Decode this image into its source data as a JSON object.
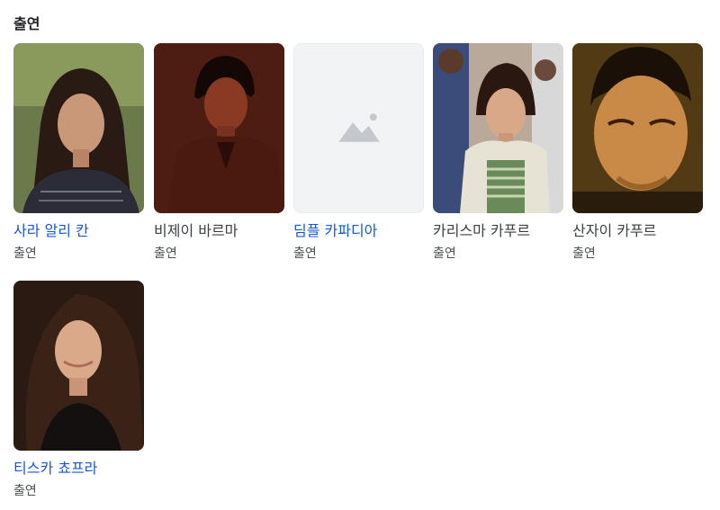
{
  "section": {
    "title": "출연"
  },
  "cast": [
    {
      "name": "사라 알리 칸",
      "role": "출연",
      "linked": true,
      "photo": "portrait-woman-longhair"
    },
    {
      "name": "비제이 바르마",
      "role": "출연",
      "linked": false,
      "photo": "portrait-man-dark"
    },
    {
      "name": "딤플 카파디아",
      "role": "출연",
      "linked": true,
      "photo": "image-placeholder-icon"
    },
    {
      "name": "카리스마 카푸르",
      "role": "출연",
      "linked": false,
      "photo": "portrait-woman-crowd"
    },
    {
      "name": "산자이 카푸르",
      "role": "출연",
      "linked": false,
      "photo": "portrait-man-closeup"
    },
    {
      "name": "티스카 쵸프라",
      "role": "출연",
      "linked": true,
      "photo": "portrait-woman-smiling"
    }
  ]
}
